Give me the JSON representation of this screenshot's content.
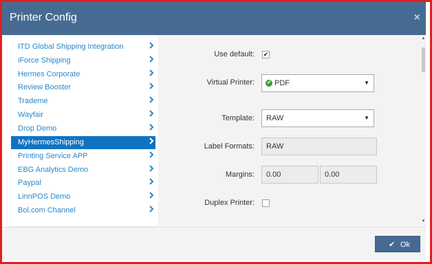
{
  "dialog": {
    "title": "Printer Config",
    "close_symbol": "×"
  },
  "sidebar": {
    "items": [
      {
        "label": "ITD Global Shipping Integration",
        "active": false
      },
      {
        "label": "iForce Shipping",
        "active": false
      },
      {
        "label": "Hermes Corporate",
        "active": false
      },
      {
        "label": "Review Booster",
        "active": false
      },
      {
        "label": "Trademe",
        "active": false
      },
      {
        "label": "Wayfair",
        "active": false
      },
      {
        "label": "Drop Demo",
        "active": false
      },
      {
        "label": "MyHermesShipping",
        "active": true
      },
      {
        "label": "Printing Service APP",
        "active": false
      },
      {
        "label": "EBG Analytics Demo",
        "active": false
      },
      {
        "label": "Paypal",
        "active": false
      },
      {
        "label": "LinnPOS Demo",
        "active": false
      },
      {
        "label": "Bol.com Channel",
        "active": false
      }
    ]
  },
  "form": {
    "use_default": {
      "label": "Use default:",
      "checked": true,
      "mark": "✔"
    },
    "virtual_printer": {
      "label": "Virtual Printer:",
      "value": "PDF",
      "icon": "check-circle-icon"
    },
    "template": {
      "label": "Template:",
      "value": "RAW"
    },
    "label_formats": {
      "label": "Label Formats:",
      "value": "RAW"
    },
    "margins": {
      "label": "Margins:",
      "value_1": "0.00",
      "value_2": "0.00"
    },
    "duplex_printer": {
      "label": "Duplex Printer:",
      "checked": false
    }
  },
  "footer": {
    "ok_label": "Ok",
    "ok_icon": "check-icon"
  },
  "colors": {
    "header": "#466b93",
    "frame_border": "#e02020",
    "active_item": "#1073c2",
    "link_text": "#2c87c8"
  }
}
